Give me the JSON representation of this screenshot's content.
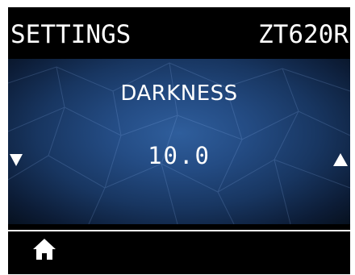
{
  "header": {
    "title": "SETTINGS",
    "model": "ZT620R"
  },
  "setting": {
    "name": "DARKNESS",
    "value": "10.0"
  },
  "controls": {
    "decrease_icon": "triangle-down-icon",
    "increase_icon": "triangle-up-icon",
    "home_icon": "home-icon"
  },
  "colors": {
    "background": "#000000",
    "panel_center": "#2f5e9c",
    "panel_edge": "#07111f",
    "text": "#ffffff"
  }
}
